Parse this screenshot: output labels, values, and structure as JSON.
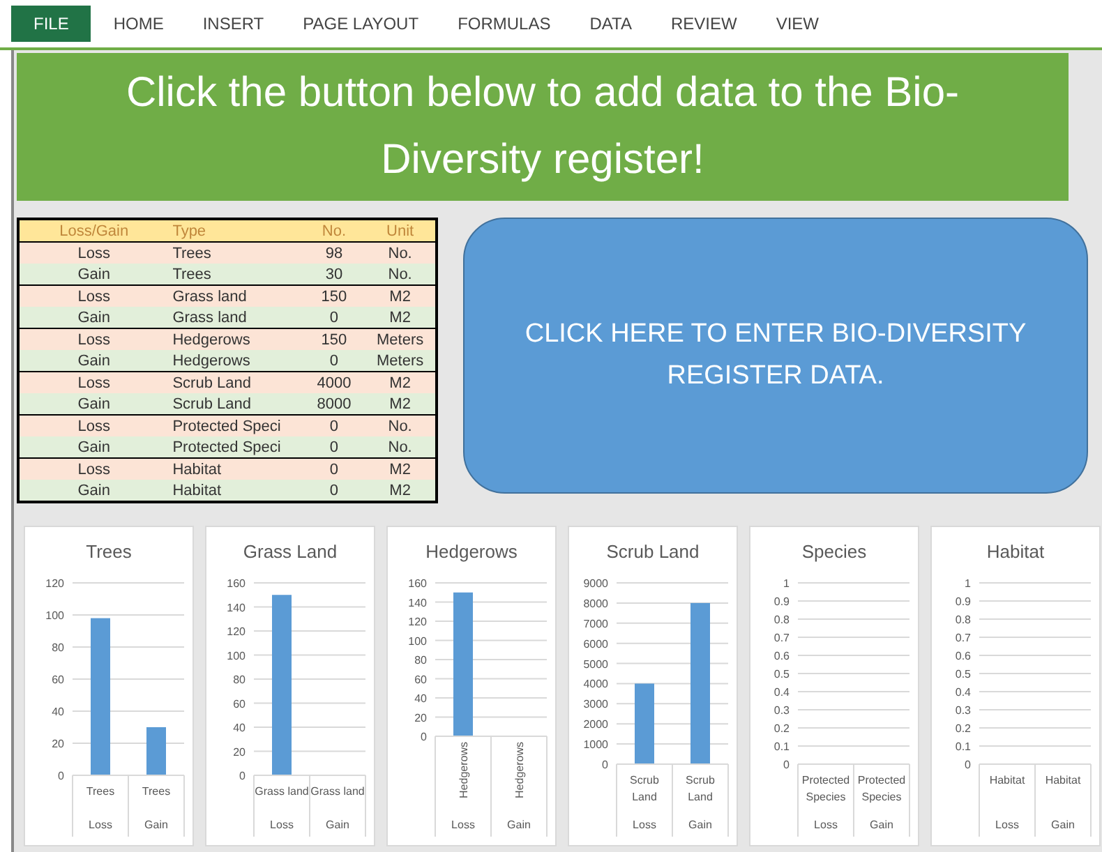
{
  "ribbon_tabs": [
    {
      "label": "FILE",
      "selected": true
    },
    {
      "label": "HOME",
      "selected": false
    },
    {
      "label": "INSERT",
      "selected": false
    },
    {
      "label": "PAGE LAYOUT",
      "selected": false
    },
    {
      "label": "FORMULAS",
      "selected": false
    },
    {
      "label": "DATA",
      "selected": false
    },
    {
      "label": "REVIEW",
      "selected": false
    },
    {
      "label": "VIEW",
      "selected": false
    }
  ],
  "banner": {
    "text": "Click the button below to add data to the Bio-Diversity register!"
  },
  "table": {
    "columns": [
      "Loss/Gain",
      "Type",
      "No.",
      "Unit"
    ],
    "rows": [
      {
        "kind": "loss",
        "cells": [
          "Loss",
          "Trees",
          "98",
          "No."
        ]
      },
      {
        "kind": "gain",
        "cells": [
          "Gain",
          "Trees",
          "30",
          "No."
        ]
      },
      {
        "kind": "loss",
        "cells": [
          "Loss",
          "Grass land",
          "150",
          "M2"
        ]
      },
      {
        "kind": "gain",
        "cells": [
          "Gain",
          "Grass land",
          "0",
          "M2"
        ]
      },
      {
        "kind": "loss",
        "cells": [
          "Loss",
          "Hedgerows",
          "150",
          "Meters"
        ]
      },
      {
        "kind": "gain",
        "cells": [
          "Gain",
          "Hedgerows",
          "0",
          "Meters"
        ]
      },
      {
        "kind": "loss",
        "cells": [
          "Loss",
          "Scrub Land",
          "4000",
          "M2"
        ]
      },
      {
        "kind": "gain",
        "cells": [
          "Gain",
          "Scrub Land",
          "8000",
          "M2"
        ]
      },
      {
        "kind": "loss",
        "cells": [
          "Loss",
          "Protected Speci",
          "0",
          "No."
        ]
      },
      {
        "kind": "gain",
        "cells": [
          "Gain",
          "Protected Speci",
          "0",
          "No."
        ]
      },
      {
        "kind": "loss",
        "cells": [
          "Loss",
          "Habitat",
          "0",
          "M2"
        ]
      },
      {
        "kind": "gain",
        "cells": [
          "Gain",
          "Habitat",
          "0",
          "M2"
        ]
      }
    ]
  },
  "enter_button": {
    "label": "CLICK HERE TO ENTER BIO-DIVERSITY REGISTER DATA."
  },
  "charts": [
    {
      "kind": "flat",
      "chart_data": {
        "type": "bar",
        "title": "Trees",
        "categories": [
          "Trees",
          "Trees"
        ],
        "annotations": [
          "Loss",
          "Gain"
        ],
        "values": [
          98,
          30
        ],
        "ylim": [
          0,
          120
        ],
        "yticks": [
          0,
          20,
          40,
          60,
          80,
          100,
          120
        ],
        "grid": true
      }
    },
    {
      "kind": "flat",
      "chart_data": {
        "type": "bar",
        "title": "Grass Land",
        "categories": [
          "Grass land",
          "Grass land"
        ],
        "annotations": [
          "Loss",
          "Gain"
        ],
        "values": [
          150,
          0
        ],
        "ylim": [
          0,
          160
        ],
        "yticks": [
          0,
          20,
          40,
          60,
          80,
          100,
          120,
          140,
          160
        ],
        "grid": true
      }
    },
    {
      "kind": "rotated",
      "chart_data": {
        "type": "bar",
        "title": "Hedgerows",
        "categories": [
          "Hedgerows",
          "Hedgerows"
        ],
        "annotations": [
          "Loss",
          "Gain"
        ],
        "values": [
          150,
          0
        ],
        "ylim": [
          0,
          160
        ],
        "yticks": [
          0,
          20,
          40,
          60,
          80,
          100,
          120,
          140,
          160
        ],
        "grid": true
      }
    },
    {
      "kind": "wrapped",
      "chart_data": {
        "type": "bar",
        "title": "Scrub Land",
        "categories": [
          "Scrub Land",
          "Scrub Land"
        ],
        "annotations": [
          "Loss",
          "Gain"
        ],
        "values": [
          4000,
          8000
        ],
        "ylim": [
          0,
          9000
        ],
        "yticks": [
          0,
          1000,
          2000,
          3000,
          4000,
          5000,
          6000,
          7000,
          8000,
          9000
        ],
        "grid": true
      }
    },
    {
      "kind": "wrapped",
      "chart_data": {
        "type": "bar",
        "title": "Species",
        "categories": [
          "Protected Species",
          "Protected Species"
        ],
        "annotations": [
          "Loss",
          "Gain"
        ],
        "values": [
          0,
          0
        ],
        "ylim": [
          0,
          1
        ],
        "yticks": [
          0,
          0.1,
          0.2,
          0.3,
          0.4,
          0.5,
          0.6,
          0.7,
          0.8,
          0.9,
          1
        ],
        "grid": true
      }
    },
    {
      "kind": "wrapped",
      "chart_data": {
        "type": "bar",
        "title": "Habitat",
        "categories": [
          "Habitat",
          "Habitat"
        ],
        "annotations": [
          "Loss",
          "Gain"
        ],
        "values": [
          0,
          0
        ],
        "ylim": [
          0,
          1
        ],
        "yticks": [
          0,
          0.1,
          0.2,
          0.3,
          0.4,
          0.5,
          0.6,
          0.7,
          0.8,
          0.9,
          1
        ],
        "grid": true
      }
    }
  ]
}
